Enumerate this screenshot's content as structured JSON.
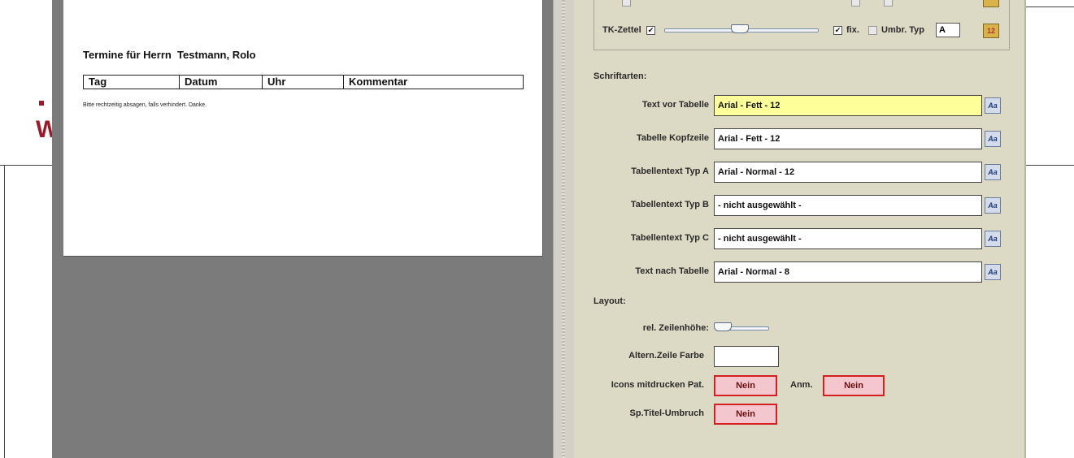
{
  "background": {
    "accent_color": "#9a1a2a",
    "letter": "W"
  },
  "preview": {
    "title": "Termine für Herrn  Testmann, Rolo",
    "table_headers": [
      "Tag",
      "Datum",
      "Uhr",
      "Kommentar"
    ],
    "note": "Bitte rechtzeitig absagen, falls verhindert. Danke."
  },
  "panel": {
    "tk_zettel_label": "TK-Zettel",
    "fix_label": "fix.",
    "umbr_typ_label": "Umbr. Typ",
    "typ_value": "A",
    "top_checks": {
      "tk_zettel": true,
      "fix": true,
      "umbr": false
    },
    "schriftarten_label": "Schriftarten:",
    "fonts": [
      {
        "label": "Text vor Tabelle",
        "value": "Arial - Fett - 12"
      },
      {
        "label": "Tabelle Kopfzeile",
        "value": "Arial - Fett - 12"
      },
      {
        "label": "Tabellentext Typ A",
        "value": "Arial - Normal - 12"
      },
      {
        "label": "Tabellentext Typ B",
        "value": "- nicht ausgewählt -"
      },
      {
        "label": "Tabellentext Typ C",
        "value": "- nicht ausgewählt -"
      },
      {
        "label": "Text nach Tabelle",
        "value": "Arial - Normal - 8"
      }
    ],
    "font_button_label": "Aa",
    "layout_label": "Layout:",
    "zeilenhoehe_label": "rel. Zeilenhöhe:",
    "altern_label": "Altern.Zeile Farbe",
    "icons_label": "Icons mitdrucken Pat.",
    "icons_value": "Nein",
    "anm_label": "Anm.",
    "anm_value": "Nein",
    "umbruch_label": "Sp.Titel-Umbruch",
    "umbruch_value": "Nein",
    "highlight_color": "#ffff99",
    "toggle_color": "#f4c7cf"
  }
}
